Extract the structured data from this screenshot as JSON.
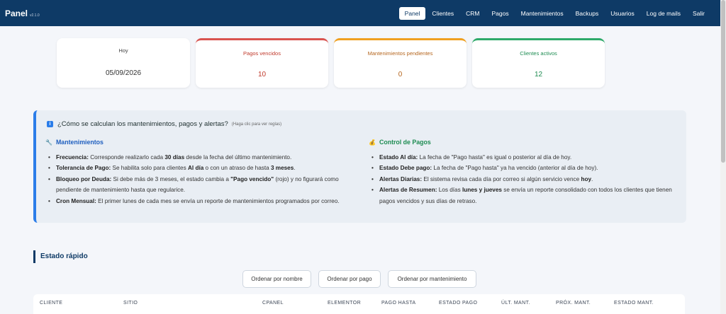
{
  "header": {
    "brand": "Panel",
    "version": "v2.1.0",
    "nav": [
      {
        "label": "Panel",
        "active": true
      },
      {
        "label": "Clientes"
      },
      {
        "label": "CRM"
      },
      {
        "label": "Pagos"
      },
      {
        "label": "Mantenimientos"
      },
      {
        "label": "Backups"
      },
      {
        "label": "Usuarios"
      },
      {
        "label": "Log de mails"
      },
      {
        "label": "Salir"
      }
    ]
  },
  "cards": [
    {
      "title": "Hoy",
      "value": "05/09/2026"
    },
    {
      "title": "Pagos vencidos",
      "value": "10",
      "color": "#d9534f"
    },
    {
      "title": "Mantenimientos pendientes",
      "value": "0",
      "color": "#f0a020"
    },
    {
      "title": "Clientes activos",
      "value": "12",
      "color": "#2eaa6a"
    }
  ],
  "info": {
    "icon": "info-icon",
    "title": "¿Cómo se calculan los mantenimientos, pagos y alertas?",
    "hint": "(Haga clic para ver reglas)",
    "left": {
      "icon": "wrench-icon",
      "title": "Mantenimientos",
      "items": [
        {
          "label": "Frecuencia:",
          "text": "Corresponde realizarlo cada 30 días desde la fecha del último mantenimiento."
        },
        {
          "label": "Tolerancia de Pago:",
          "text": "Se habilita solo para clientes Al día o con un atraso de hasta 3 meses."
        },
        {
          "label": "Bloqueo por Deuda:",
          "text": "Si debe más de 3 meses, el estado cambia a \"Pago vencido\" (rojo) y no figurará como pendiente de mantenimiento hasta que regularice."
        },
        {
          "label": "Cron Mensual:",
          "text": "El primer lunes de cada mes se envía un reporte de mantenimientos programados por correo."
        }
      ]
    },
    "right": {
      "icon": "money-bag-icon",
      "title": "Control de Pagos",
      "items": [
        {
          "label": "Estado Al día:",
          "text": "La fecha de \"Pago hasta\" es igual o posterior al día de hoy."
        },
        {
          "label": "Estado Debe pago:",
          "text": "La fecha de \"Pago hasta\" ya ha vencido (anterior al día de hoy)."
        },
        {
          "label": "Alertas Diarias:",
          "text": "El sistema revisa cada día por correo si algún servicio vence hoy."
        },
        {
          "label": "Alertas de Resumen:",
          "text": "Los días lunes y jueves se envía un reporte consolidado con todos los clientes que tienen pagos vencidos y sus días de retraso."
        }
      ]
    }
  },
  "quick": {
    "title": "Estado rápido",
    "sort_buttons": [
      "Ordenar por nombre",
      "Ordenar por pago",
      "Ordenar por mantenimiento"
    ],
    "columns": [
      "CLIENTE",
      "SITIO",
      "CPANEL",
      "ELEMENTOR",
      "PAGO HASTA",
      "ESTADO PAGO",
      "ÚLT. MANT.",
      "PRÓX. MANT.",
      "ESTADO MANT."
    ]
  }
}
